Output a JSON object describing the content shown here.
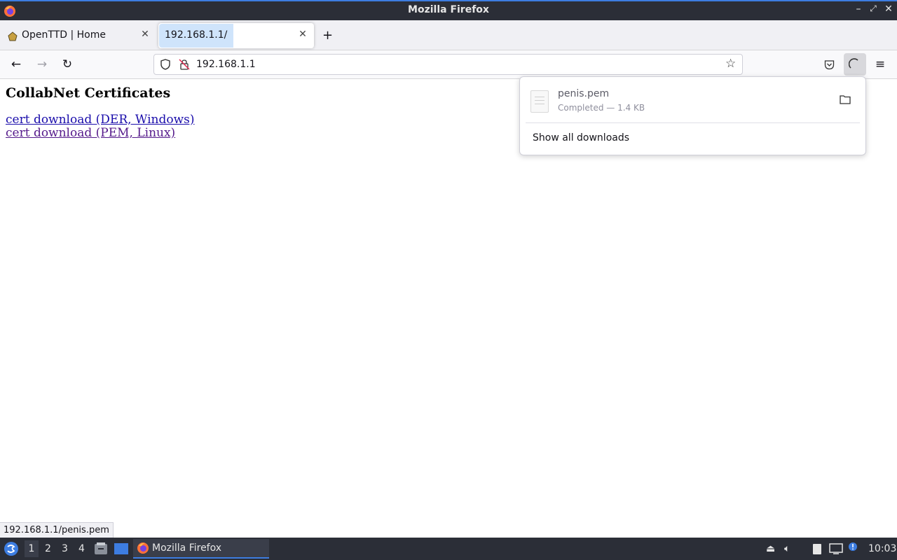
{
  "window": {
    "title": "Mozilla Firefox"
  },
  "tabs": [
    {
      "label": "OpenTTD | Home"
    },
    {
      "label": "192.168.1.1/"
    }
  ],
  "navbar": {
    "url": "192.168.1.1"
  },
  "page": {
    "heading": "CollabNet Certificates",
    "links": [
      "cert download (DER, Windows)",
      "cert download (PEM, Linux)"
    ]
  },
  "downloads": {
    "filename": "penis.pem",
    "status": "Completed — 1.4 KB",
    "show_all": "Show all downloads"
  },
  "statusbar": {
    "text": "192.168.1.1/penis.pem"
  },
  "taskbar": {
    "workspaces": [
      "1",
      "2",
      "3",
      "4"
    ],
    "app_label": "Mozilla Firefox",
    "clock": "10:03"
  },
  "colors": {
    "accent": "#3d7de1",
    "link": "#1a0dab",
    "visited": "#551a8b",
    "panel_bg": "#2b2e37"
  },
  "icons": [
    "firefox-logo-icon",
    "minimize-icon",
    "maximize-icon",
    "close-icon",
    "back-icon",
    "forward-icon",
    "reload-icon",
    "shield-icon",
    "lock-insecure-icon",
    "bookmark-star-icon",
    "pocket-icon",
    "downloads-icon",
    "menu-icon",
    "folder-icon",
    "file-icon"
  ]
}
